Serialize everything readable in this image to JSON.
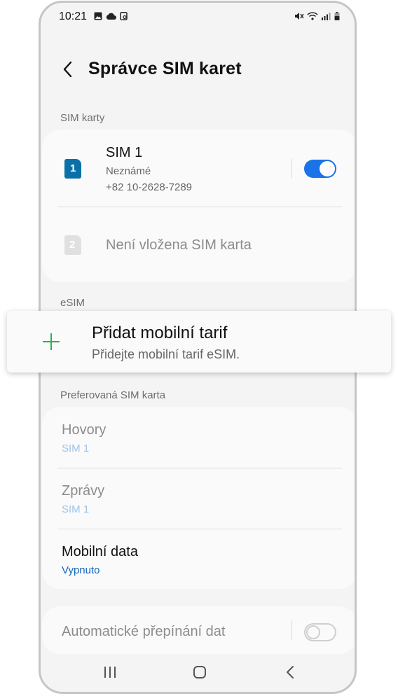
{
  "status_bar": {
    "time": "10:21"
  },
  "header": {
    "title": "Správce SIM karet"
  },
  "sections": {
    "sim_cards": "SIM karty",
    "esim": "eSIM",
    "preferred": "Preferovaná SIM karta"
  },
  "sim1": {
    "icon_number": "1",
    "name": "SIM 1",
    "status": "Neznámé",
    "phone": "+82 10-2628-7289",
    "enabled": true
  },
  "sim2": {
    "icon_number": "2",
    "label": "Není vložena SIM karta"
  },
  "add_plan": {
    "title": "Přidat mobilní tarif",
    "subtitle": "Přidejte mobilní tarif eSIM."
  },
  "preferred": {
    "calls": {
      "label": "Hovory",
      "value": "SIM 1"
    },
    "messages": {
      "label": "Zprávy",
      "value": "SIM 1"
    },
    "mobile_data": {
      "label": "Mobilní data",
      "value": "Vypnuto"
    }
  },
  "auto_switch": {
    "label": "Automatické přepínání dat",
    "enabled": false
  },
  "colors": {
    "accent": "#1a73e8",
    "sim_blue": "#0b70a8",
    "plus_green": "#2db34a",
    "disabled_text": "#8c8c8c",
    "link_light": "#9ec4ea"
  }
}
